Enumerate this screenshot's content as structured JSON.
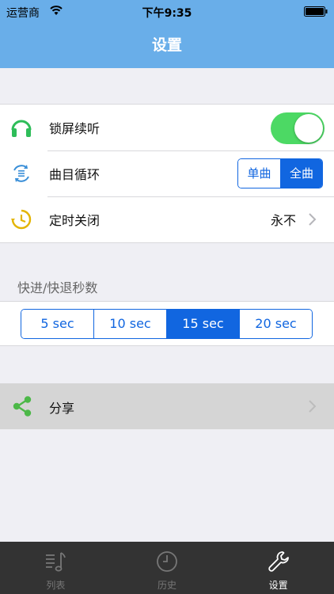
{
  "status_bar": {
    "carrier": "运营商",
    "time": "下午9:35"
  },
  "nav": {
    "title": "设置"
  },
  "settings": {
    "lock_screen": {
      "label": "锁屏续听",
      "enabled": true
    },
    "loop": {
      "label": "曲目循环",
      "options": [
        "单曲",
        "全曲"
      ],
      "selected": "全曲"
    },
    "timer": {
      "label": "定时关闭",
      "value": "永不"
    }
  },
  "seek": {
    "header": "快进/快退秒数",
    "options": [
      "5 sec",
      "10 sec",
      "15 sec",
      "20 sec"
    ],
    "selected": "15 sec"
  },
  "share": {
    "label": "分享"
  },
  "tabs": [
    {
      "label": "列表",
      "icon": "music-list-icon",
      "active": false
    },
    {
      "label": "历史",
      "icon": "clock-icon",
      "active": false
    },
    {
      "label": "设置",
      "icon": "wrench-icon",
      "active": true
    }
  ],
  "colors": {
    "nav": "#69aee9",
    "accent": "#1166e0",
    "switch_on": "#4cd964",
    "headphone": "#2ebd59",
    "timer": "#e3b400",
    "share": "#4cb848",
    "tabbar": "#333333"
  }
}
